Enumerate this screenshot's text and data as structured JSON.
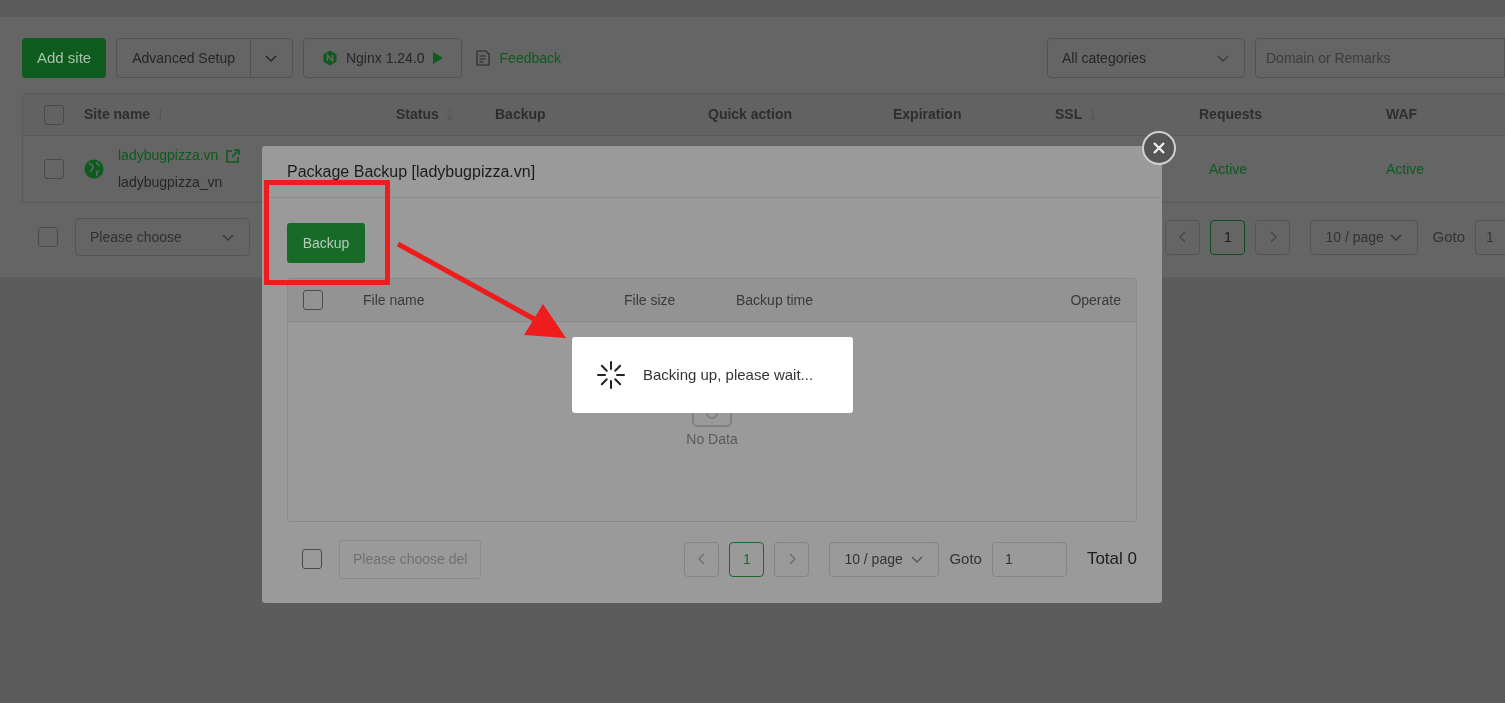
{
  "toolbar": {
    "add_site": "Add site",
    "advanced_setup": "Advanced Setup",
    "nginx": "Nginx 1.24.0",
    "feedback": "Feedback",
    "category_select": "All categories",
    "search_placeholder": "Domain or Remarks"
  },
  "table": {
    "columns": [
      {
        "label": "Site name",
        "sortable": true
      },
      {
        "label": "Status",
        "sortable": true
      },
      {
        "label": "Backup",
        "sortable": false
      },
      {
        "label": "Quick action",
        "sortable": false
      },
      {
        "label": "Expiration",
        "sortable": false
      },
      {
        "label": "SSL",
        "sortable": true
      },
      {
        "label": "Requests",
        "sortable": false
      },
      {
        "label": "WAF",
        "sortable": false
      }
    ],
    "all_checked": false,
    "rows": [
      {
        "site_name": "ladybugpizza.vn",
        "remark": "ladybugpizza_vn",
        "requests": "Active",
        "waf": "Active",
        "checked": false
      }
    ]
  },
  "footer": {
    "all_checked": false,
    "batch_placeholder": "Please choose",
    "pages": [
      {
        "label": "1",
        "selected": true
      }
    ],
    "page_size": "10 / page",
    "goto_label": "Goto",
    "goto_value": "1"
  },
  "modal": {
    "title": "Package Backup [ladybugpizza.vn]",
    "backup_button": "Backup",
    "header_checked": false,
    "footer_checked": false,
    "columns": [
      "File name",
      "File size",
      "Backup time",
      "Operate"
    ],
    "empty_text": "No Data",
    "delete_placeholder": "Please choose del",
    "pages": [
      {
        "label": "1",
        "selected": true
      }
    ],
    "page_size": "10 / page",
    "goto_label": "Goto",
    "goto_value": "1",
    "total": "Total 0"
  },
  "loading": {
    "text": "Backing up, please wait..."
  }
}
